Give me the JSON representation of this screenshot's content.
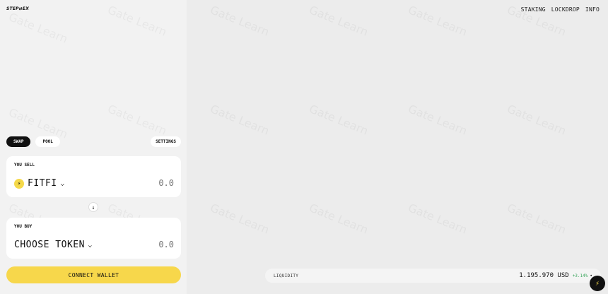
{
  "brand": {
    "logo_text": "STEP⇄EX"
  },
  "nav": {
    "items": [
      "STAKING",
      "LOCKDROP",
      "INFO"
    ]
  },
  "tabs": {
    "swap": "SWAP",
    "pool": "POOL",
    "settings": "SETTINGS"
  },
  "sell": {
    "label": "YOU SELL",
    "token": "FITFI",
    "token_icon": "fitfi-token-icon",
    "amount_placeholder": "0.0"
  },
  "buy": {
    "label": "YOU BUY",
    "token": "CHOOSE TOKEN",
    "amount_placeholder": "0.0"
  },
  "swap_direction_icon": "arrow-down-icon",
  "connect_wallet": "CONNECT WALLET",
  "liquidity": {
    "label": "LIQUIDITY",
    "value": "1.195.970 USD",
    "change": "+3.14%",
    "change_color": "#3aa65c"
  },
  "watermark_text": "Gate Learn",
  "colors": {
    "accent": "#f7d74b",
    "dark": "#111111",
    "background": "#ececec"
  }
}
